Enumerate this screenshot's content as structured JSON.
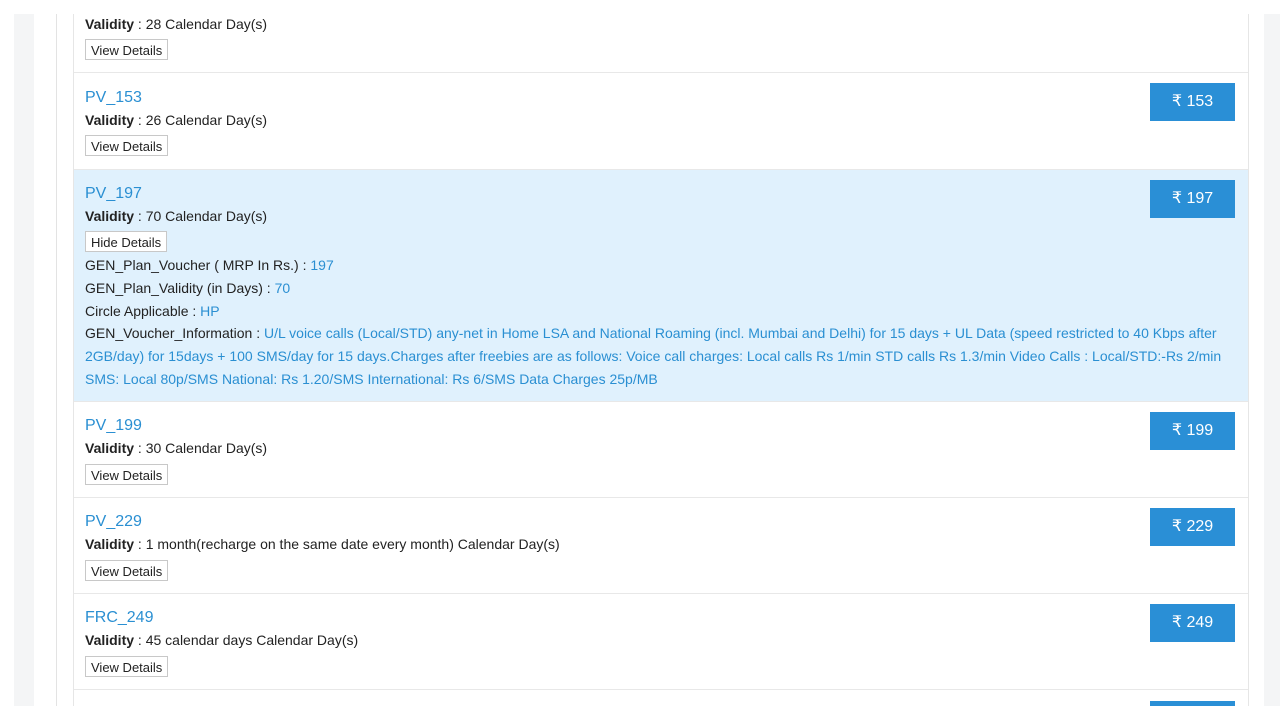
{
  "labels": {
    "validity": "Validity",
    "sep": " : ",
    "currency": "₹",
    "view_details": "View Details",
    "hide_details": "Hide Details"
  },
  "plans": [
    {
      "name": "",
      "validity": "28 Calendar Day(s)",
      "price": ""
    },
    {
      "name": "PV_153",
      "validity": "26 Calendar Day(s)",
      "price": "153"
    },
    {
      "name": "PV_197",
      "validity": "70 Calendar Day(s)",
      "price": "197"
    },
    {
      "name": "PV_199",
      "validity": "30 Calendar Day(s)",
      "price": "199"
    },
    {
      "name": "PV_229",
      "validity": "1 month(recharge on the same date every month) Calendar Day(s)",
      "price": "229"
    },
    {
      "name": "FRC_249",
      "validity": "45 calendar days Calendar Day(s)",
      "price": "249"
    }
  ],
  "expanded": {
    "mrp_label": "GEN_Plan_Voucher ( MRP In Rs.) : ",
    "mrp_value": "197",
    "validity_label": "GEN_Plan_Validity (in Days) : ",
    "validity_value": "70",
    "circle_label": "Circle Applicable : ",
    "circle_value": "HP",
    "info_label": "GEN_Voucher_Information : ",
    "info_value": "U/L voice calls (Local/STD) any-net in Home LSA and National Roaming (incl. Mumbai and Delhi) for 15 days + UL Data (speed restricted to 40 Kbps after 2GB/day) for 15days + 100 SMS/day for 15 days.Charges after freebies are as follows: Voice call charges: Local calls Rs 1/min STD calls Rs 1.3/min Video Calls : Local/STD:-Rs 2/min SMS: Local 80p/SMS National: Rs 1.20/SMS International: Rs 6/SMS Data Charges 25p/MB"
  }
}
